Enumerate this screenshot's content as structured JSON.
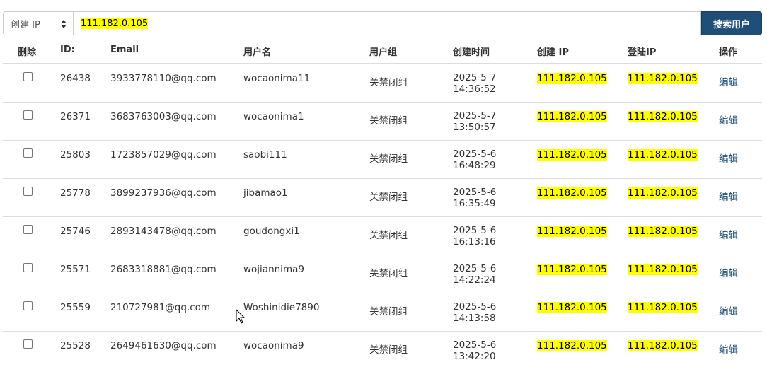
{
  "search": {
    "select_value": "创建 IP",
    "input_value": "111.182.0.105",
    "button_label": "搜索用户"
  },
  "table": {
    "headers": [
      "删除",
      "ID:",
      "Email",
      "用户名",
      "用户组",
      "创建时间",
      "创建 IP",
      "登陆IP",
      "操作"
    ],
    "rows": [
      {
        "id": "26438",
        "email": "3933778110@qq.com",
        "username": "wocaonima11",
        "group": "关禁闭组",
        "date": "2025-5-7",
        "time": "14:36:52",
        "create_ip": "111.182.0.105",
        "login_ip": "111.182.0.105",
        "action": "编辑"
      },
      {
        "id": "26371",
        "email": "3683763003@qq.com",
        "username": "wocaonima1",
        "group": "关禁闭组",
        "date": "2025-5-7",
        "time": "13:50:57",
        "create_ip": "111.182.0.105",
        "login_ip": "111.182.0.105",
        "action": "编辑"
      },
      {
        "id": "25803",
        "email": "1723857029@qq.com",
        "username": "saobi111",
        "group": "关禁闭组",
        "date": "2025-5-6",
        "time": "16:48:29",
        "create_ip": "111.182.0.105",
        "login_ip": "111.182.0.105",
        "action": "编辑"
      },
      {
        "id": "25778",
        "email": "3899237936@qq.com",
        "username": "jibamao1",
        "group": "关禁闭组",
        "date": "2025-5-6",
        "time": "16:35:49",
        "create_ip": "111.182.0.105",
        "login_ip": "111.182.0.105",
        "action": "编辑"
      },
      {
        "id": "25746",
        "email": "2893143478@qq.com",
        "username": "goudongxi1",
        "group": "关禁闭组",
        "date": "2025-5-6",
        "time": "16:13:16",
        "create_ip": "111.182.0.105",
        "login_ip": "111.182.0.105",
        "action": "编辑"
      },
      {
        "id": "25571",
        "email": "2683318881@qq.com",
        "username": "wojiannima9",
        "group": "关禁闭组",
        "date": "2025-5-6",
        "time": "14:22:24",
        "create_ip": "111.182.0.105",
        "login_ip": "111.182.0.105",
        "action": "编辑"
      },
      {
        "id": "25559",
        "email": "210727981@qq.com",
        "username": "Woshinidie7890",
        "group": "关禁闭组",
        "date": "2025-5-6",
        "time": "14:13:58",
        "create_ip": "111.182.0.105",
        "login_ip": "111.182.0.105",
        "action": "编辑"
      },
      {
        "id": "25528",
        "email": "2649461630@qq.com",
        "username": "wocaonima9",
        "group": "关禁闭组",
        "date": "2025-5-6",
        "time": "13:42:20",
        "create_ip": "111.182.0.105",
        "login_ip": "111.182.0.105",
        "action": "编辑"
      }
    ]
  },
  "colors": {
    "highlight": "#ffff00",
    "button_bg": "#1f4e79",
    "link": "#1f4e79",
    "row_border": "#dddddd"
  }
}
